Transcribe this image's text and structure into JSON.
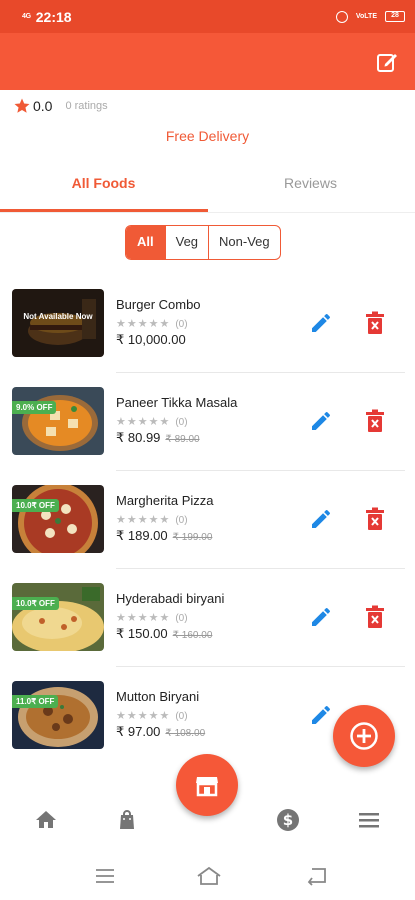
{
  "status_bar": {
    "network": "4G",
    "time": "22:18",
    "volte": "VoLTE",
    "battery": "28"
  },
  "restaurant": {
    "rating_value": "0.0",
    "rating_count": "0 ratings",
    "delivery_note": "Free Delivery"
  },
  "tabs": [
    {
      "label": "All Foods",
      "active": true
    },
    {
      "label": "Reviews",
      "active": false
    }
  ],
  "filters": [
    {
      "label": "All",
      "selected": true
    },
    {
      "label": "Veg",
      "selected": false
    },
    {
      "label": "Non-Veg",
      "selected": false
    }
  ],
  "foods": [
    {
      "name": "Burger Combo",
      "stars": "★★★★★",
      "rating_count": "(0)",
      "price": "₹ 10,000.00",
      "old_price": "",
      "badge": "",
      "overlay": "Not Available Now"
    },
    {
      "name": "Paneer Tikka Masala",
      "stars": "★★★★★",
      "rating_count": "(0)",
      "price": "₹ 80.99",
      "old_price": "₹ 89.00",
      "badge": "9.0% OFF",
      "overlay": ""
    },
    {
      "name": "Margherita Pizza",
      "stars": "★★★★★",
      "rating_count": "(0)",
      "price": "₹ 189.00",
      "old_price": "₹ 199.00",
      "badge": "10.0₹ OFF",
      "overlay": ""
    },
    {
      "name": "Hyderabadi biryani",
      "stars": "★★★★★",
      "rating_count": "(0)",
      "price": "₹ 150.00",
      "old_price": "₹ 160.00",
      "badge": "10.0₹ OFF",
      "overlay": ""
    },
    {
      "name": "Mutton Biryani",
      "stars": "★★★★★",
      "rating_count": "(0)",
      "price": "₹ 97.00",
      "old_price": "₹ 108.00",
      "badge": "11.0₹ OFF",
      "overlay": ""
    }
  ],
  "colors": {
    "primary": "#f55838",
    "accent_text": "#f05a36",
    "edit_blue": "#1e88e5",
    "delete_red": "#e53935",
    "badge_green": "#4caf50",
    "nav_icon": "#757575"
  },
  "icons": {
    "app_bar_action": "edit-square-icon",
    "fab_add": "add-circle-icon",
    "fab_center": "store-icon",
    "bottom_nav": [
      "home-icon",
      "bag-icon",
      "dollar-icon",
      "menu-icon"
    ],
    "system_nav": [
      "recents-icon",
      "home-icon",
      "back-icon"
    ]
  }
}
